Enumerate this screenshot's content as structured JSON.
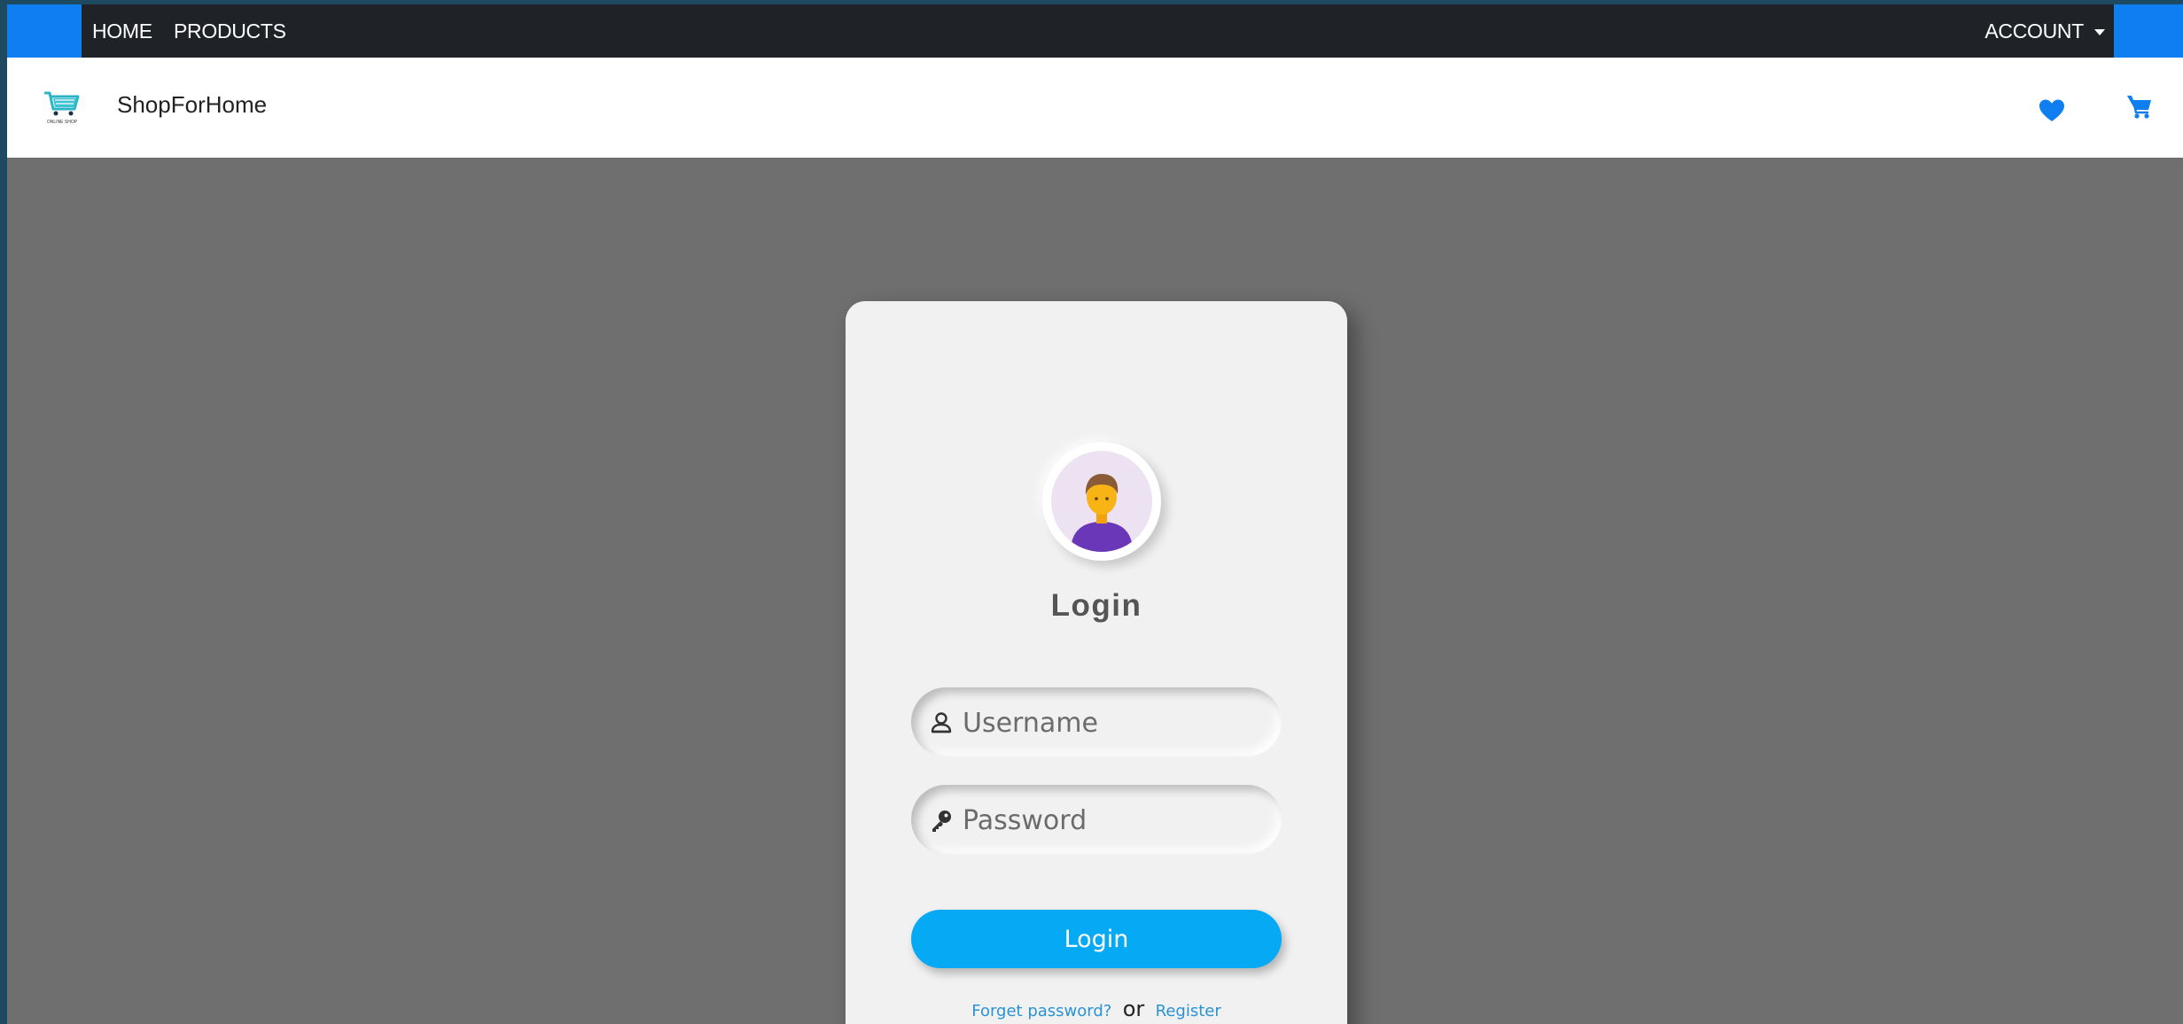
{
  "topnav": {
    "home_label": "HOME",
    "products_label": "PRODUCTS",
    "account_label": "ACCOUNT"
  },
  "brand": {
    "name": "ShopForHome",
    "logo_text": "ONLINE SHOP"
  },
  "header_icons": {
    "wishlist": "heart-icon",
    "cart": "cart-icon"
  },
  "login": {
    "title": "Login",
    "username_placeholder": "Username",
    "password_placeholder": "Password",
    "submit_label": "Login",
    "forgot_label": "Forget password?",
    "or_label": "or",
    "register_label": "Register"
  },
  "colors": {
    "accent_blue": "#0f7ef0",
    "login_button": "#05a9f4",
    "link": "#2a93d6",
    "overlay": "#6f6f6f",
    "nav_dark": "#1f2327"
  }
}
